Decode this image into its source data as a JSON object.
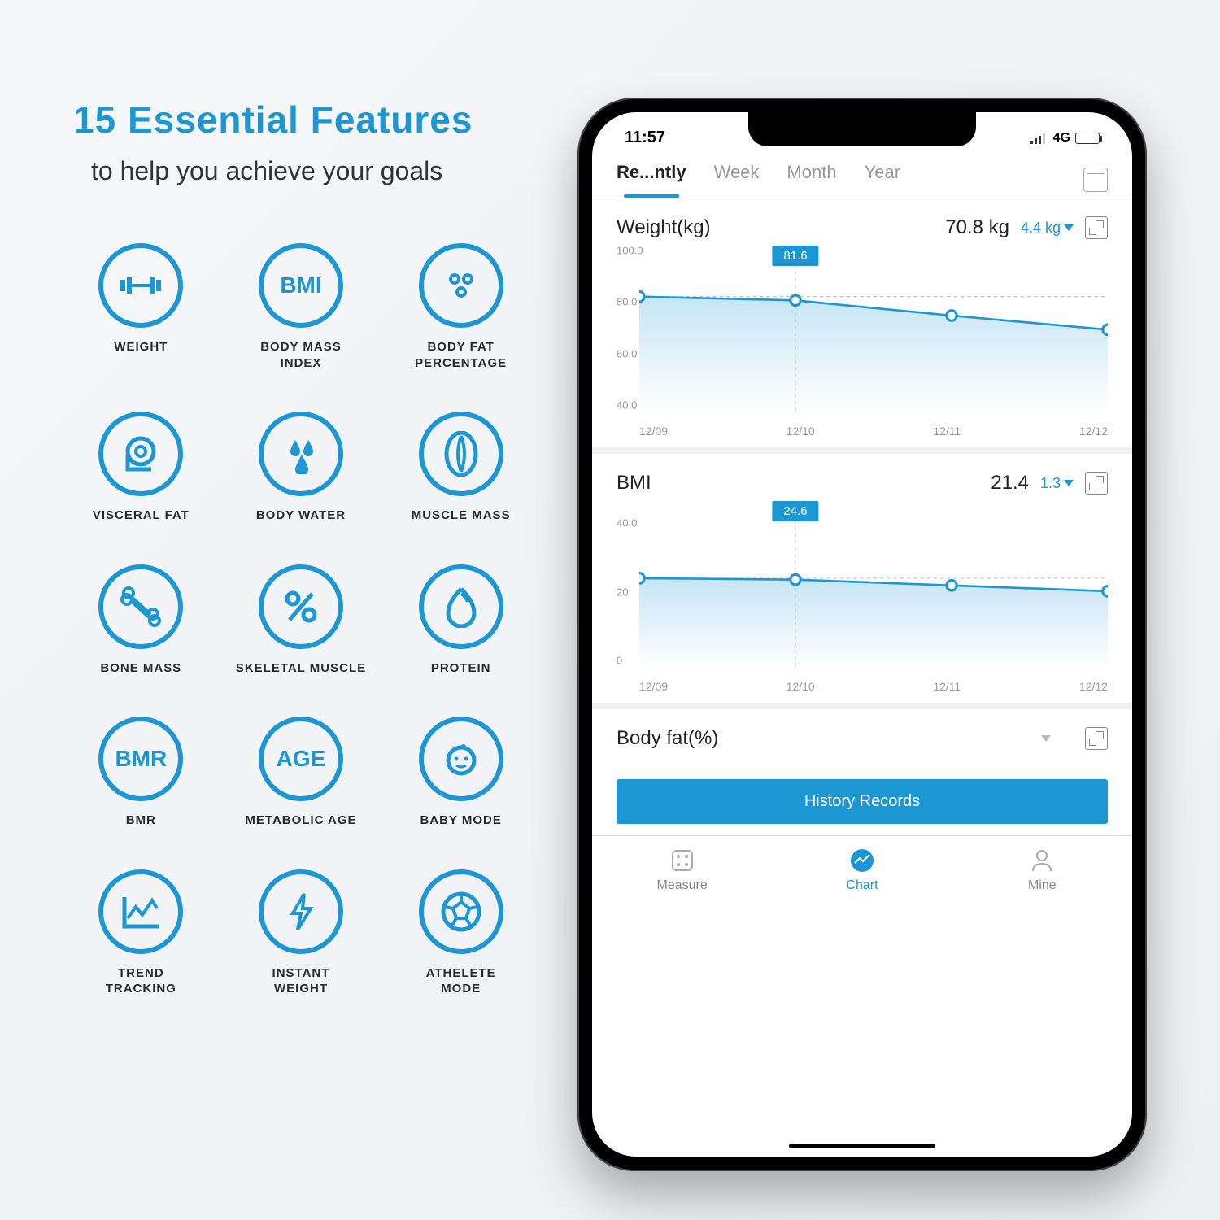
{
  "headline": "15 Essential Features",
  "subhead": "to help you achieve your goals",
  "features": [
    {
      "label": "WEIGHT",
      "icon": "barbell"
    },
    {
      "label": "BODY MASS\nINDEX",
      "icon": "BMI"
    },
    {
      "label": "BODY FAT\nPERCENTAGE",
      "icon": "dots"
    },
    {
      "label": "VISCERAL FAT",
      "icon": "tape"
    },
    {
      "label": "BODY WATER",
      "icon": "drops"
    },
    {
      "label": "MUSCLE MASS",
      "icon": "muscle"
    },
    {
      "label": "BONE MASS",
      "icon": "bone"
    },
    {
      "label": "SKELETAL MUSCLE",
      "icon": "percent"
    },
    {
      "label": "PROTEIN",
      "icon": "egg"
    },
    {
      "label": "BMR",
      "icon": "BMR"
    },
    {
      "label": "METABOLIC AGE",
      "icon": "AGE"
    },
    {
      "label": "BABY MODE",
      "icon": "baby"
    },
    {
      "label": "TREND\nTRACKING",
      "icon": "trend"
    },
    {
      "label": "INSTANT\nWEIGHT",
      "icon": "bolt"
    },
    {
      "label": "ATHELETE\nMODE",
      "icon": "ball"
    }
  ],
  "status": {
    "time": "11:57",
    "net": "4G"
  },
  "tabs": [
    "Re...ntly",
    "Week",
    "Month",
    "Year"
  ],
  "active_tab": 0,
  "metrics": {
    "weight": {
      "title": "Weight(kg)",
      "value": "70.8 kg",
      "delta": "4.4 kg",
      "tooltip": "81.6"
    },
    "bmi": {
      "title": "BMI",
      "value": "21.4",
      "delta": "1.3",
      "tooltip": "24.6"
    },
    "bodyfat": {
      "title": "Body fat(%)"
    }
  },
  "history_btn": "History Records",
  "bottom": {
    "measure": "Measure",
    "chart": "Chart",
    "mine": "Mine"
  },
  "chart_data": [
    {
      "type": "line",
      "title": "Weight(kg)",
      "x": [
        "12/09",
        "12/10",
        "12/11",
        "12/12"
      ],
      "values": [
        83.0,
        81.6,
        76.0,
        70.8
      ],
      "ylim": [
        40,
        100
      ],
      "yticks": [
        40,
        60,
        80,
        100
      ],
      "tooltip_point": 1,
      "tooltip_value": "81.6"
    },
    {
      "type": "line",
      "title": "BMI",
      "x": [
        "12/09",
        "12/10",
        "12/11",
        "12/12"
      ],
      "values": [
        25.0,
        24.6,
        23.0,
        21.4
      ],
      "ylim": [
        0,
        45
      ],
      "yticks": [
        0,
        20,
        40
      ],
      "tooltip_point": 1,
      "tooltip_value": "24.6"
    }
  ]
}
